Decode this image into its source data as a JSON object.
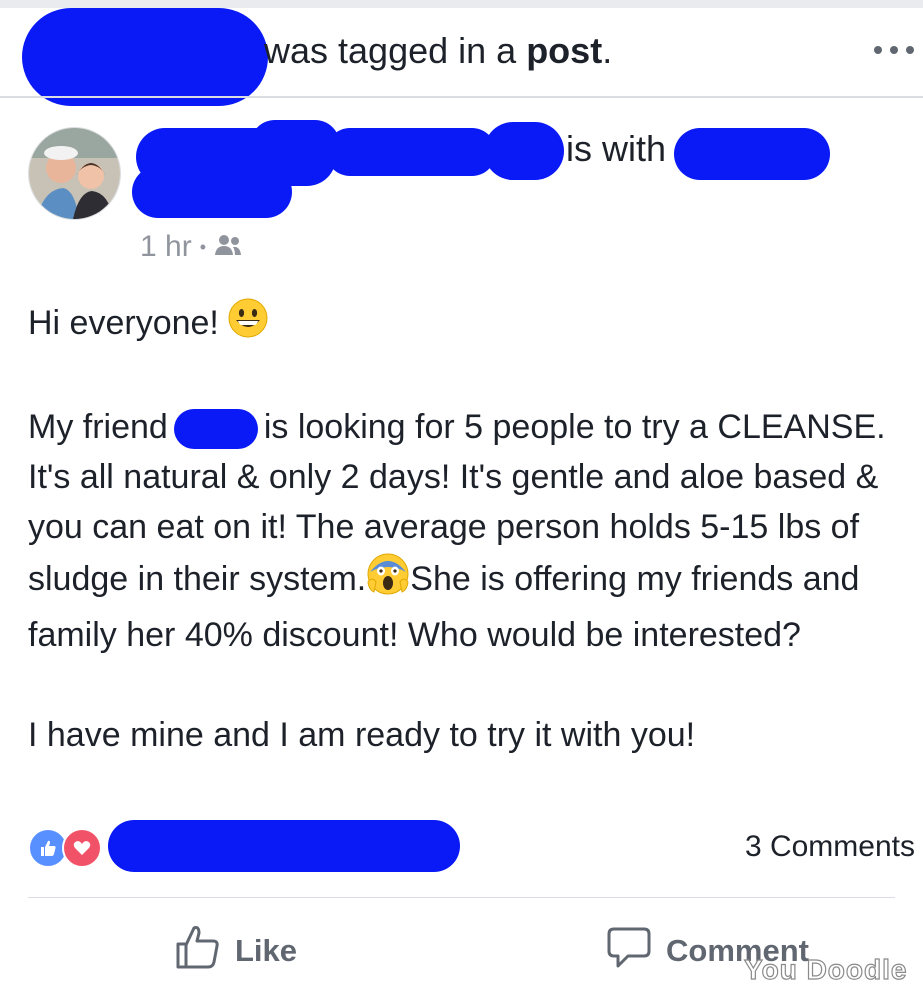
{
  "notification": {
    "text_before": "was tagged in a ",
    "link_text": "post",
    "text_after": "."
  },
  "post": {
    "is_with": "is with",
    "time": "1 hr",
    "separator": "•",
    "audience_icon": "friends-icon",
    "body": {
      "greeting": "Hi everyone!",
      "para1_pre": "My friend",
      "para1_post": "is looking for 5 people to try a CLEANSE. It's all natural & only 2 days! It's gentle and aloe based & you can eat on it! The average person holds 5-15 lbs of sludge in their system.",
      "para1_end": "She is offering my friends and family her 40% discount! Who would be interested?",
      "para2": "I have mine and I am ready to try it with you!"
    },
    "reactions": [
      "like",
      "love"
    ],
    "comments_count": "3 Comments"
  },
  "actions": {
    "like_label": "Like",
    "comment_label": "Comment"
  },
  "watermark": "You Doodle",
  "colors": {
    "redaction": "#0a1af7",
    "like_blue": "#5890ff",
    "love_red": "#f25268"
  }
}
